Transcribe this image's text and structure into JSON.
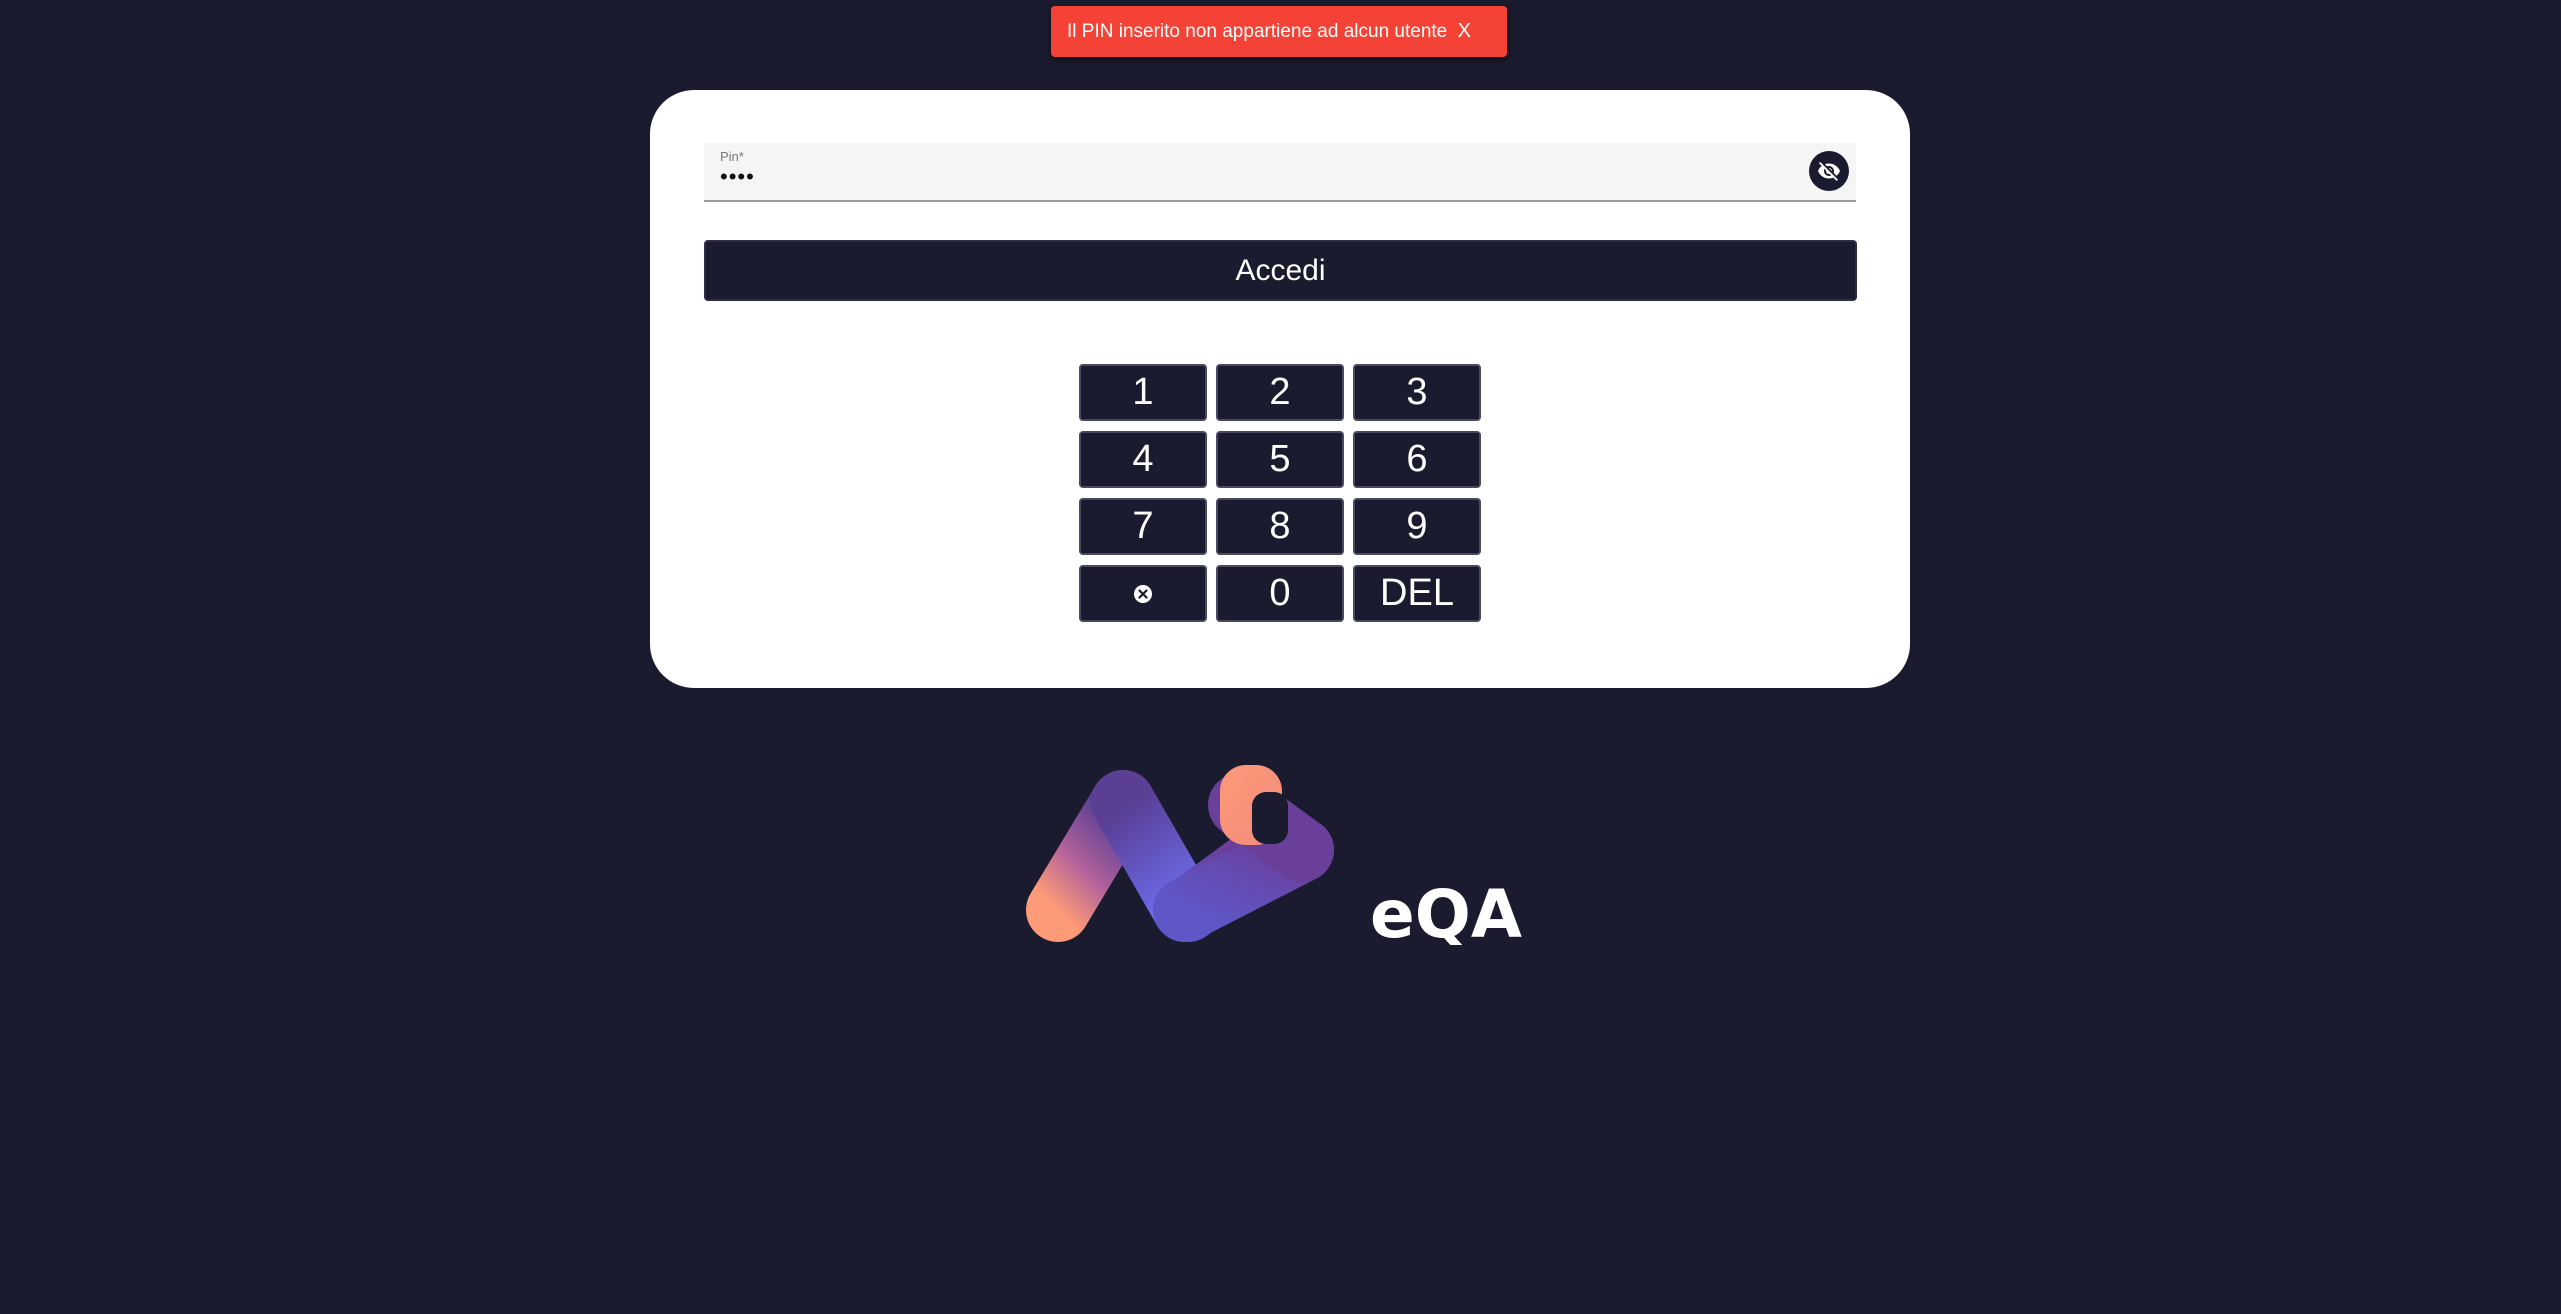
{
  "toast": {
    "message": "Il PIN inserito non appartiene ad alcun utente",
    "close_label": "X",
    "color": "#f44336"
  },
  "login": {
    "pin_label": "Pin*",
    "pin_value": "••••",
    "submit_label": "Accedi"
  },
  "keypad": {
    "keys": [
      "1",
      "2",
      "3",
      "4",
      "5",
      "6",
      "7",
      "8",
      "9",
      "",
      "0",
      "DEL"
    ],
    "clear_icon": "cancel-circle-icon"
  },
  "logo": {
    "text": "eQA"
  },
  "colors": {
    "background": "#1b1b2f",
    "card": "#ffffff",
    "accent_orange": "#fd9a78",
    "accent_purple": "#6b63e6"
  }
}
